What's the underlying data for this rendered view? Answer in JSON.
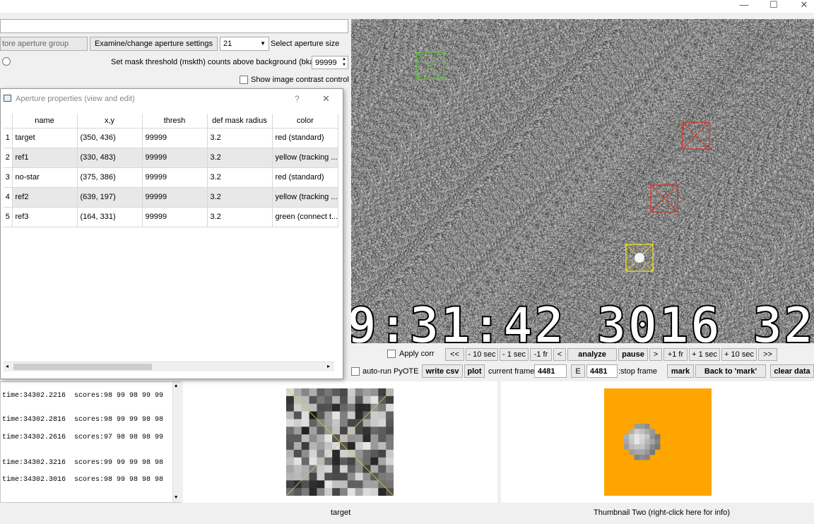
{
  "window": {
    "minimize": "—",
    "maximize": "☐",
    "close": "✕"
  },
  "top_controls": {
    "store_group_button": "tore aperture group",
    "examine_button": "Examine/change aperture settings",
    "aperture_size_select": "21",
    "aperture_size_label": "Select aperture size",
    "mask_threshold_label": "Set mask threshold (mskth) counts above background (bkavg)",
    "mask_threshold_value": "99999",
    "contrast_label": "Show image contrast control"
  },
  "dialog": {
    "title": "Aperture properties (view and edit)",
    "help": "?",
    "close": "✕",
    "columns": [
      "name",
      "x,y",
      "thresh",
      "def mask radius",
      "color"
    ],
    "rows": [
      {
        "idx": "1",
        "name": "target",
        "xy": "(350, 436)",
        "thresh": "99999",
        "radius": "3.2",
        "color": "red (standard)"
      },
      {
        "idx": "2",
        "name": "ref1",
        "xy": "(330, 483)",
        "thresh": "99999",
        "radius": "3.2",
        "color": "yellow (tracking ..."
      },
      {
        "idx": "3",
        "name": "no-star",
        "xy": "(375, 386)",
        "thresh": "99999",
        "radius": "3.2",
        "color": "red (standard)"
      },
      {
        "idx": "4",
        "name": "ref2",
        "xy": "(639, 197)",
        "thresh": "99999",
        "radius": "3.2",
        "color": "yellow (tracking ..."
      },
      {
        "idx": "5",
        "name": "ref3",
        "xy": "(164, 331)",
        "thresh": "99999",
        "radius": "3.2",
        "color": "green (connect t..."
      }
    ]
  },
  "video": {
    "overlay_text": "9:31:42  3016  32"
  },
  "playback": {
    "apply_corr": "Apply corr",
    "first": "<<",
    "back10": "- 10 sec",
    "back1": "- 1 sec",
    "backfr": "-1 fr",
    "prev": "<",
    "analyze": "analyze",
    "pause": "pause",
    "next": ">",
    "fwdfr": "+1 fr",
    "fwd1": "+ 1 sec",
    "fwd10": "+ 10 sec",
    "last": ">>"
  },
  "actions": {
    "autorun": "auto-run PyOTE",
    "write_csv": "write csv",
    "plot": "plot",
    "current_frame_label": "current frame:",
    "current_frame": "4481",
    "e_button": "E",
    "stop_frame": "4481",
    "stop_frame_label": ":stop frame",
    "mark": "mark",
    "back_to_mark": "Back to 'mark'",
    "clear_data": "clear data"
  },
  "log": [
    "time:34302.2216  scores:98 99 98 99 99",
    "time:34302.2816  scores:98 99 99 98 98",
    "time:34302.2616  scores:97 98 98 98 99",
    "time:34302.3216  scores:99 99 99 98 98",
    "time:34302.3016  scores:98 99 98 98 98"
  ],
  "status": {
    "thumb_one": "target",
    "thumb_two": "Thumbnail Two (right-click here for info)"
  },
  "colors": {
    "thumb_two_bg": "#ffa500",
    "aperture_green": "#5fbf3a",
    "aperture_red": "#d43c2c",
    "aperture_yellow": "#e6d431"
  }
}
